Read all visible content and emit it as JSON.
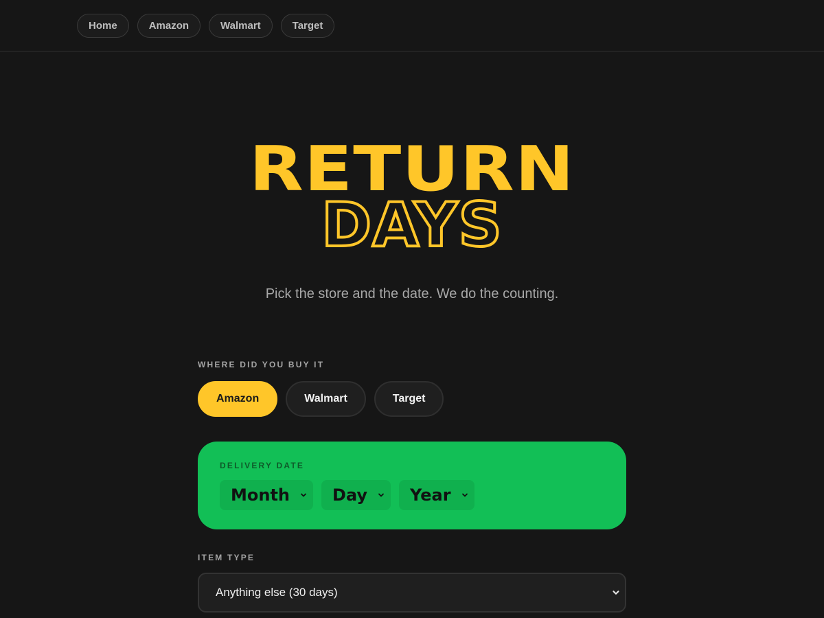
{
  "nav": {
    "items": [
      {
        "label": "Home"
      },
      {
        "label": "Amazon"
      },
      {
        "label": "Walmart"
      },
      {
        "label": "Target"
      }
    ]
  },
  "hero": {
    "title_line1": "RETURN",
    "title_line2": "DAYS",
    "subtitle": "Pick the store and the date. We do the counting."
  },
  "stores": {
    "label": "WHERE DID YOU BUY IT",
    "options": [
      {
        "label": "Amazon",
        "selected": true
      },
      {
        "label": "Walmart",
        "selected": false
      },
      {
        "label": "Target",
        "selected": false
      }
    ]
  },
  "delivery": {
    "label": "DELIVERY DATE",
    "month": "Month",
    "day": "Day",
    "year": "Year"
  },
  "item_type": {
    "label": "ITEM TYPE",
    "selected": "Anything else (30 days)"
  },
  "colors": {
    "accent": "#ffc629",
    "date_card": "#12bf56",
    "background": "#161616"
  }
}
